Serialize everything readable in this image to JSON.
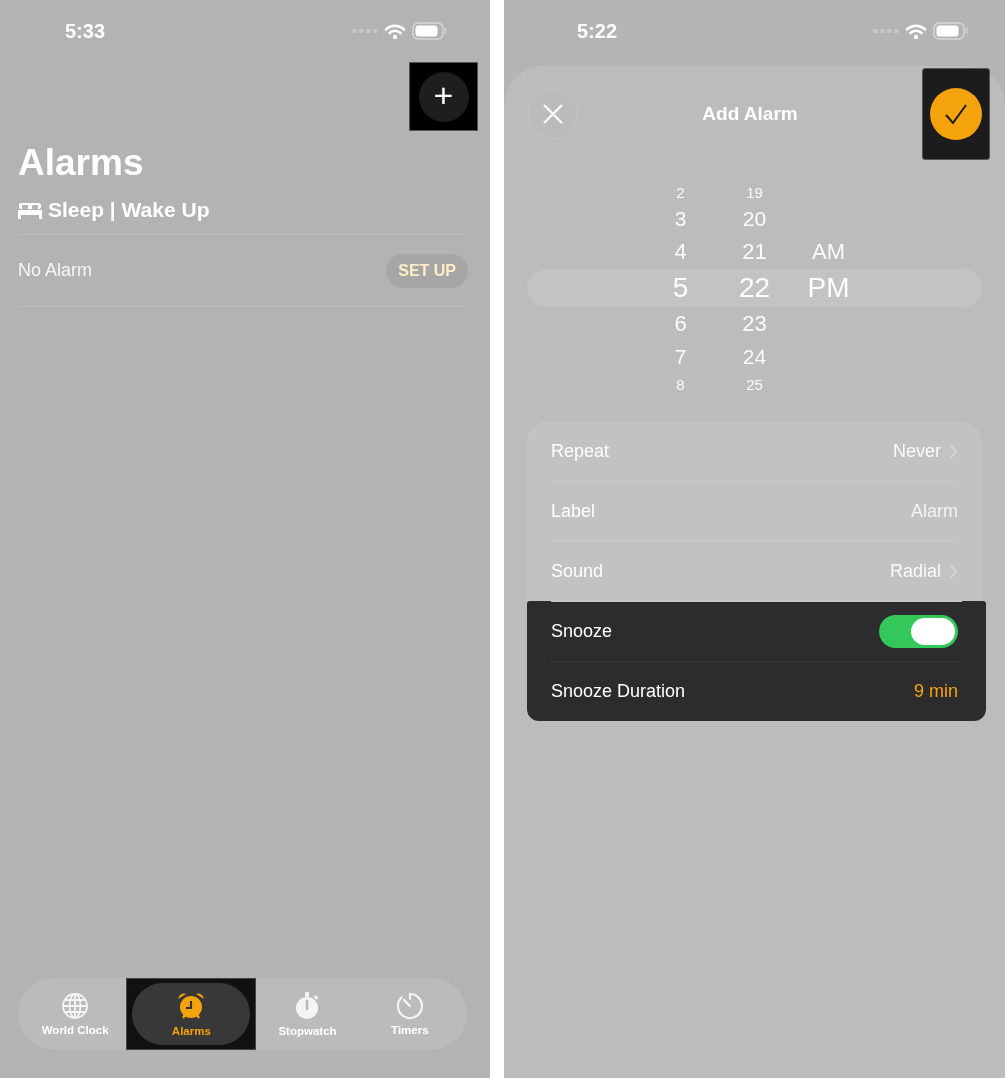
{
  "left_screen": {
    "status_bar": {
      "time": "5:33"
    },
    "add_button": {
      "label": "+",
      "highlighted": true
    },
    "title": "Alarms",
    "sleep_section": {
      "title": "Sleep | Wake Up"
    },
    "sleep_row": {
      "text": "No Alarm",
      "button": "SET UP"
    },
    "tabs": [
      {
        "label": "World Clock",
        "kind": "globe",
        "selected": false,
        "highlighted": false
      },
      {
        "label": "Alarms",
        "kind": "alarm",
        "selected": true,
        "highlighted": true
      },
      {
        "label": "Stopwatch",
        "kind": "stopwatch",
        "selected": false,
        "highlighted": false
      },
      {
        "label": "Timers",
        "kind": "timer",
        "selected": false,
        "highlighted": false
      }
    ]
  },
  "right_screen": {
    "status_bar": {
      "time": "5:22"
    },
    "sheet": {
      "title": "Add Alarm",
      "confirm_highlighted": true,
      "picker": [
        {
          "items": [
            {
              "text": "2",
              "selected": false
            },
            {
              "text": "3",
              "selected": false
            },
            {
              "text": "4",
              "selected": false
            },
            {
              "text": "5",
              "selected": true
            },
            {
              "text": "6",
              "selected": false
            },
            {
              "text": "7",
              "selected": false
            },
            {
              "text": "8",
              "selected": false
            }
          ]
        },
        {
          "items": [
            {
              "text": "19",
              "selected": false
            },
            {
              "text": "20",
              "selected": false
            },
            {
              "text": "21",
              "selected": false
            },
            {
              "text": "22",
              "selected": true
            },
            {
              "text": "23",
              "selected": false
            },
            {
              "text": "24",
              "selected": false
            },
            {
              "text": "25",
              "selected": false
            }
          ]
        },
        {
          "items": [
            {
              "text": "AM",
              "selected": false
            },
            {
              "text": "PM",
              "selected": true
            }
          ]
        }
      ],
      "settings": [
        {
          "kind": "link",
          "label": "Repeat",
          "value": "Never",
          "highlighted": false
        },
        {
          "kind": "field",
          "label": "Label",
          "placeholder": "Alarm",
          "highlighted": false
        },
        {
          "kind": "link",
          "label": "Sound",
          "value": "Radial",
          "highlighted": false
        },
        {
          "kind": "toggle",
          "label": "Snooze",
          "on": true,
          "highlighted": true
        },
        {
          "kind": "value",
          "label": "Snooze Duration",
          "value": "9 min",
          "highlighted": true
        }
      ]
    }
  }
}
